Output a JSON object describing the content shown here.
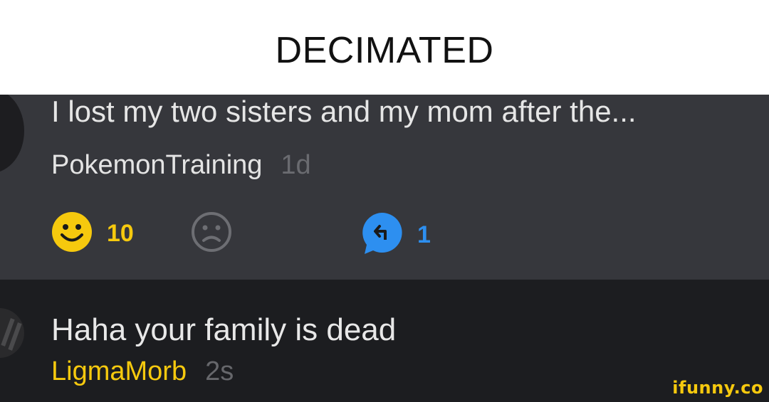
{
  "caption": "DECIMATED",
  "comments": [
    {
      "text": "I lost my two sisters and my mom after the...",
      "author": "PokemonTraining",
      "time": "1d",
      "likes": "10",
      "replies": "1"
    },
    {
      "text": "Haha your family is dead",
      "author": "LigmaMorb",
      "time": "2s"
    }
  ],
  "watermark": "ifunny.co",
  "colors": {
    "accent_gold": "#f6c90e",
    "reply_blue": "#2d8ff0",
    "card_top": "#36373c",
    "card_bottom": "#1c1d20"
  },
  "icons": [
    "smile-icon",
    "frown-icon",
    "reply-bubble-icon"
  ]
}
